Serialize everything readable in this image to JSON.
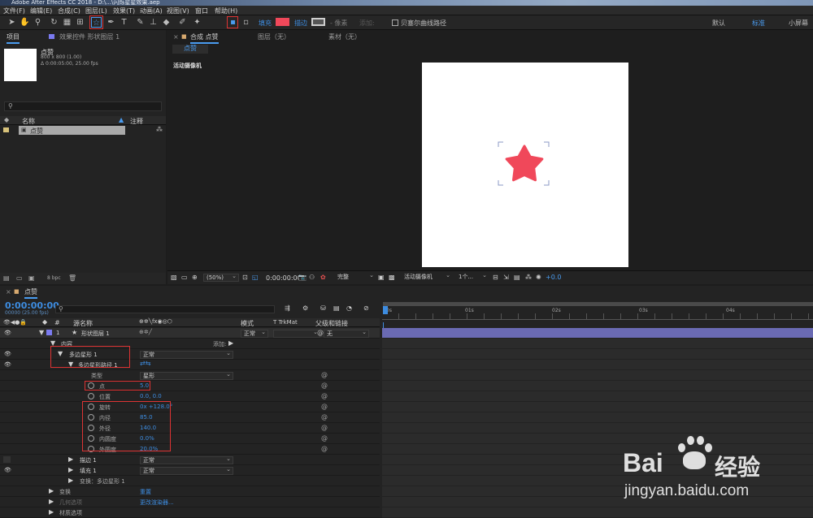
{
  "app_title": "Adobe After Effects CC 2018 - D:\\...\\闪烁星星效果.aep",
  "menu": [
    "文件(F)",
    "编辑(E)",
    "合成(C)",
    "图层(L)",
    "效果(T)",
    "动画(A)",
    "视图(V)",
    "窗口",
    "帮助(H)"
  ],
  "toolbar": {
    "fill_label": "填充",
    "stroke_label": "描边",
    "pixel_label": "- 像素",
    "add_label": "添加:",
    "bezier_label": "贝塞尔曲线路径",
    "fill_color": "#f0485a",
    "stroke_color": "#555555"
  },
  "workspaces": [
    "默认",
    "标准",
    "小屏幕"
  ],
  "project": {
    "tab": "项目",
    "effects_tab": "效果控件 形状图层 1",
    "comp_name": "点赞",
    "comp_size": "800 x 800 (1.00)",
    "comp_duration": "Δ 0:00:05:00, 25.00 fps",
    "col_name": "名称",
    "col_comment": "注释",
    "item_name": "点赞",
    "bpc": "8 bpc"
  },
  "viewer": {
    "tab": "合成 点赞",
    "layer_tab": "图层（无）",
    "footage_tab": "素材（无）",
    "crumb": "点赞",
    "camera_label": "活动摄像机",
    "zoom": "(50%)",
    "time": "0:00:00:00",
    "quality": "完整",
    "camera": "活动摄像机",
    "views": "1个...",
    "exposure": "+0.0",
    "star_color": "#f0485a"
  },
  "timeline": {
    "tab": "点赞",
    "timecode": "0:00:00:00",
    "frame_info": "00000 (25.00 fps)",
    "col_source": "源名称",
    "col_mode": "模式",
    "col_trk": "T  TrkMat",
    "col_parent": "父级和链接",
    "ruler": [
      "0s",
      "01s",
      "02s",
      "03s",
      "04s"
    ],
    "layer": {
      "num": "1",
      "name": "形状图层 1",
      "mode": "正常",
      "parent": "无"
    },
    "content": "内容",
    "add": "添加:",
    "polystar": "多边星形 1",
    "polystar_mode": "正常",
    "path": "多边星形路径 1",
    "type_label": "类型",
    "type_value": "星形",
    "props": [
      {
        "name": "点",
        "value": "5.0"
      },
      {
        "name": "位置",
        "value": "0.0, 0.0"
      },
      {
        "name": "旋转",
        "value": "0x +128.0°"
      },
      {
        "name": "内径",
        "value": "85.0"
      },
      {
        "name": "外径",
        "value": "140.0"
      },
      {
        "name": "内圆度",
        "value": "0.0%"
      },
      {
        "name": "外圆度",
        "value": "20.0%"
      }
    ],
    "stroke": "描边 1",
    "stroke_mode": "正常",
    "fill": "填充 1",
    "fill_mode": "正常",
    "transform_poly": "变换：多边星形 1",
    "transform": "变换",
    "transform_reset": "重置",
    "geometry": "几何选项",
    "geometry_renderer": "更改渲染器...",
    "material": "材质选项"
  },
  "watermark": {
    "brand": "Bai",
    "brand2": "经验",
    "url": "jingyan.baidu.com"
  }
}
